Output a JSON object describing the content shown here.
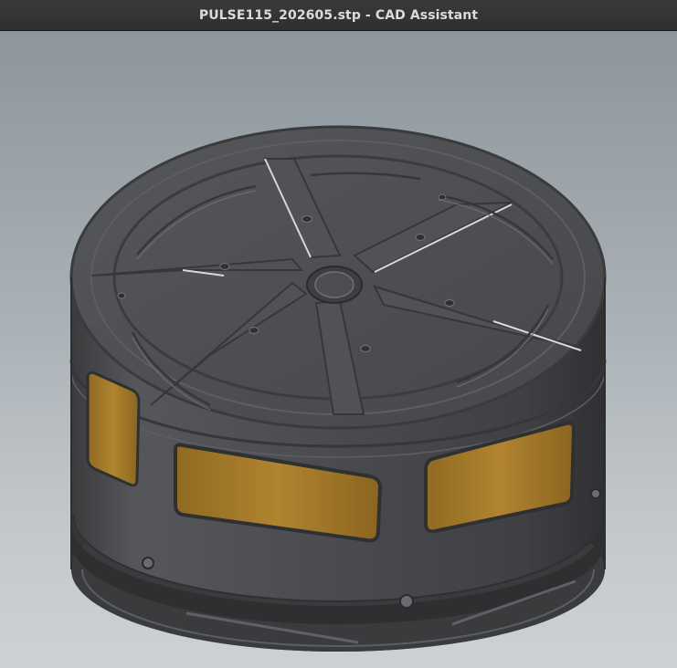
{
  "window": {
    "title": "PULSE115_202605.stp - CAD Assistant"
  },
  "viewport": {
    "background_top": "#8d969d",
    "background_bottom": "#cdd1d4",
    "model": {
      "body_color": "#4a4b4d",
      "winding_color": "#a87c2a"
    }
  }
}
